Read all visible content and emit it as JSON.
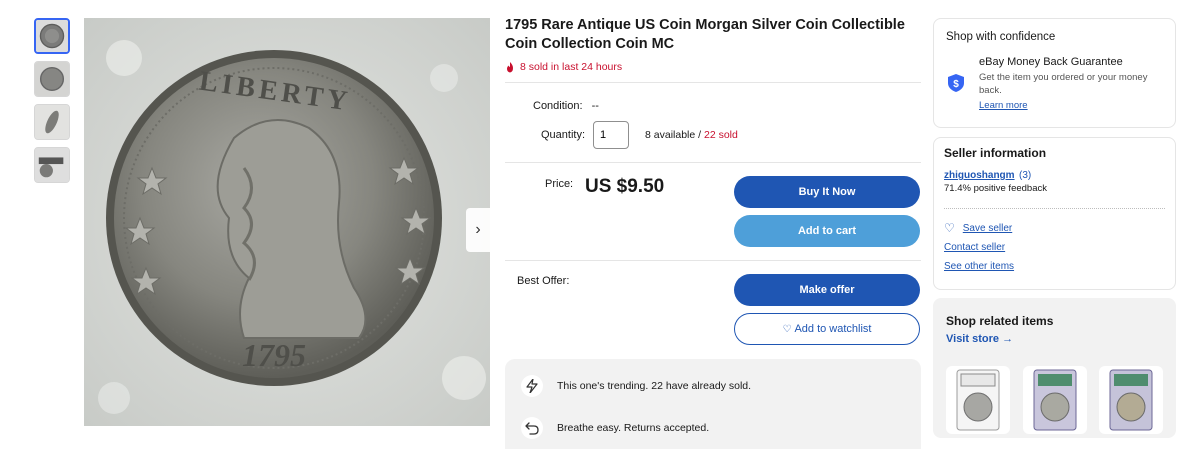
{
  "listing": {
    "title": "1795 Rare Antique US Coin Morgan Silver Coin Collectible Coin Collection Coin MC",
    "sold_recent": "8 sold in last 24 hours",
    "condition_label": "Condition:",
    "condition_value": "--",
    "quantity_label": "Quantity:",
    "quantity_value": "1",
    "available_text": "8 available /",
    "sold_text": "22 sold",
    "price_label": "Price:",
    "price": "US $9.50",
    "best_offer_label": "Best Offer:",
    "image": {
      "legend": "LIBERTY",
      "year": "1795"
    }
  },
  "buttons": {
    "buy_now": "Buy It Now",
    "add_to_cart": "Add to cart",
    "make_offer": "Make offer",
    "watchlist": "Add to watchlist"
  },
  "highlights": [
    {
      "icon": "lightning-icon",
      "text": "This one's trending. 22 have already sold."
    },
    {
      "icon": "return-arrow-icon",
      "text": "Breathe easy. Returns accepted."
    }
  ],
  "confidence": {
    "title": "Shop with confidence",
    "guarantee_title": "eBay Money Back Guarantee",
    "guarantee_text": "Get the item you ordered or your money back.",
    "learn_more": "Learn more"
  },
  "seller": {
    "title": "Seller information",
    "name": "zhiguoshangm",
    "count": "(3)",
    "feedback": "71.4% positive feedback",
    "save_seller": "Save seller",
    "contact": "Contact seller",
    "other_items": "See other items"
  },
  "related": {
    "title": "Shop related items",
    "visit_store": "Visit store"
  },
  "colors": {
    "primary_blue": "#1f56b3",
    "secondary_blue": "#4e9fd9",
    "alert_red": "#c8102e",
    "panel_gray": "#f2f2f2"
  }
}
